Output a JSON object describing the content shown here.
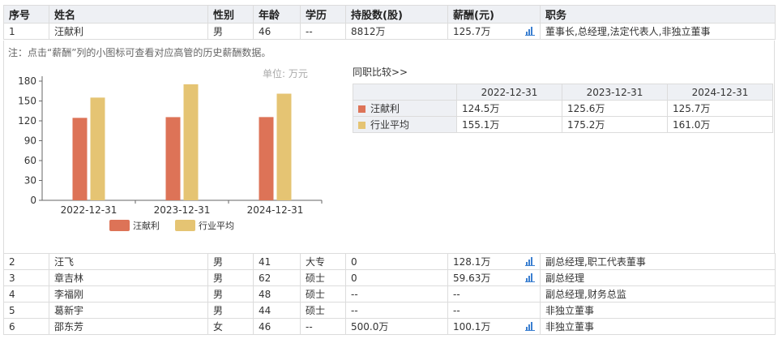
{
  "headers": [
    "序号",
    "姓名",
    "性别",
    "年龄",
    "学历",
    "持股数(股)",
    "薪酬(元)",
    "职务"
  ],
  "expanded_row": {
    "no": "1",
    "name": "汪献利",
    "gender": "男",
    "age": "46",
    "edu": "--",
    "shares": "8812万",
    "salary": "125.7万",
    "title": "董事长,总经理,法定代表人,非独立董事",
    "has_chart": true
  },
  "note": "注：点击“薪酬”列的小图标可查看对应高管的历史薪酬数据。",
  "unit_label": "单位: 万元",
  "compare_title": "同职比较>>",
  "compare": {
    "years": [
      "2022-12-31",
      "2023-12-31",
      "2024-12-31"
    ],
    "rows": [
      {
        "label": "汪献利",
        "values": [
          "124.5万",
          "125.6万",
          "125.7万"
        ]
      },
      {
        "label": "行业平均",
        "values": [
          "155.1万",
          "175.2万",
          "161.0万"
        ]
      }
    ]
  },
  "colors": {
    "person": "#dd7357",
    "industry": "#e5c473",
    "icon": "#3b7fd0",
    "header_bg": "#eef0f4"
  },
  "chart_data": {
    "type": "bar",
    "categories": [
      "2022-12-31",
      "2023-12-31",
      "2024-12-31"
    ],
    "series": [
      {
        "name": "汪献利",
        "values": [
          124.5,
          125.6,
          125.7
        ]
      },
      {
        "name": "行业平均",
        "values": [
          155.1,
          175.2,
          161.0
        ]
      }
    ],
    "ylim": [
      0,
      180
    ],
    "yticks": [
      0,
      30,
      60,
      90,
      120,
      150,
      180
    ],
    "ylabel": "单位: 万元",
    "legend": "bottom",
    "grid": false
  },
  "rows": [
    {
      "no": "2",
      "name": "汪飞",
      "gender": "男",
      "age": "41",
      "edu": "大专",
      "shares": "0",
      "salary": "128.1万",
      "title": "副总经理,职工代表董事",
      "has_chart": true
    },
    {
      "no": "3",
      "name": "章吉林",
      "gender": "男",
      "age": "62",
      "edu": "硕士",
      "shares": "0",
      "salary": "59.63万",
      "title": "副总经理",
      "has_chart": true
    },
    {
      "no": "4",
      "name": "李福刚",
      "gender": "男",
      "age": "48",
      "edu": "硕士",
      "shares": "--",
      "salary": "--",
      "title": "副总经理,财务总监",
      "has_chart": false
    },
    {
      "no": "5",
      "name": "葛新宇",
      "gender": "男",
      "age": "44",
      "edu": "硕士",
      "shares": "--",
      "salary": "--",
      "title": "非独立董事",
      "has_chart": false
    },
    {
      "no": "6",
      "name": "邵东芳",
      "gender": "女",
      "age": "46",
      "edu": "--",
      "shares": "500.0万",
      "salary": "100.1万",
      "title": "非独立董事",
      "has_chart": true
    }
  ]
}
